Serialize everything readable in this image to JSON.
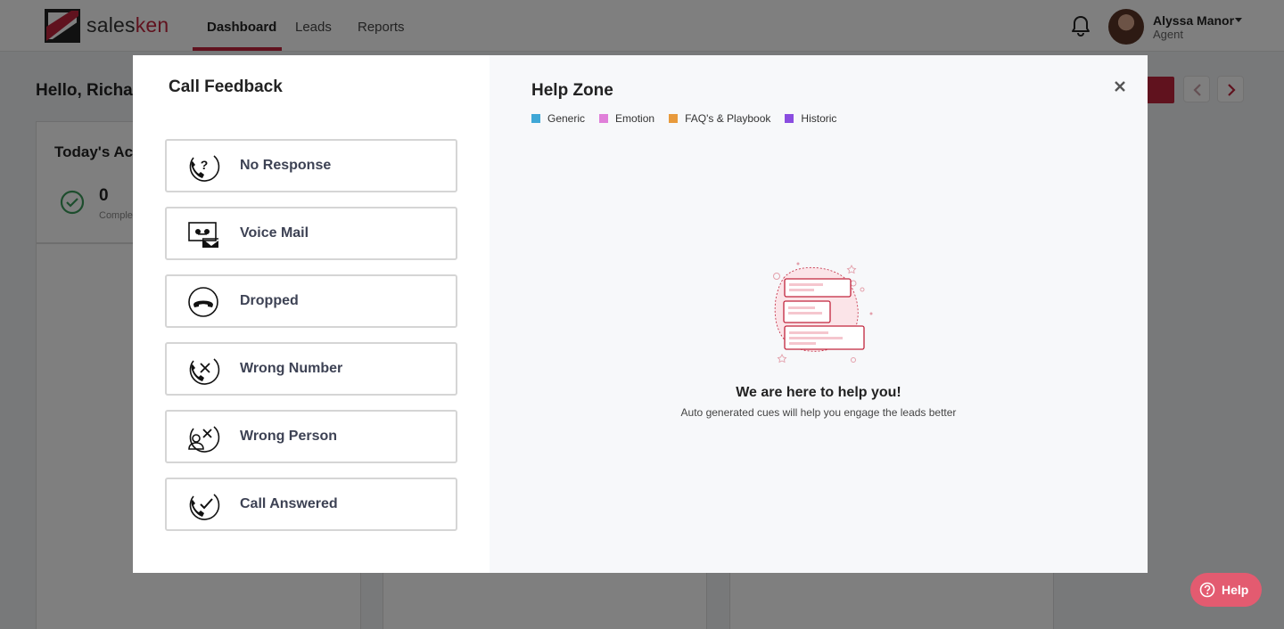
{
  "app": {
    "brand_prefix": "sales",
    "brand_suffix": "ken",
    "nav": [
      "Dashboard",
      "Leads",
      "Reports"
    ],
    "active_nav": "Dashboard",
    "accent": "#c1243c",
    "user": {
      "name": "Alyssa Manor",
      "role": "Agent"
    }
  },
  "page": {
    "greeting": "Hello, Richa",
    "activity_card": {
      "title": "Today's Act",
      "count": "0",
      "count_label": "Comple"
    }
  },
  "modal": {
    "left_title": "Call Feedback",
    "options": [
      {
        "label": "No Response",
        "icon": "phone-question-icon"
      },
      {
        "label": "Voice Mail",
        "icon": "voicemail-icon"
      },
      {
        "label": "Dropped",
        "icon": "phone-hangup-icon"
      },
      {
        "label": "Wrong Number",
        "icon": "phone-x-icon"
      },
      {
        "label": "Wrong Person",
        "icon": "person-x-icon"
      },
      {
        "label": "Call Answered",
        "icon": "phone-check-icon"
      }
    ],
    "help_zone": {
      "title": "Help Zone",
      "legend": [
        {
          "label": "Generic",
          "color": "#3fa7d6"
        },
        {
          "label": "Emotion",
          "color": "#e07fd9"
        },
        {
          "label": "FAQ's & Playbook",
          "color": "#e89a3c"
        },
        {
          "label": "Historic",
          "color": "#8a4de0"
        }
      ],
      "heading": "We are here to help you!",
      "subtext": "Auto generated cues will help you engage the leads better"
    }
  },
  "help_button": {
    "label": "Help"
  }
}
